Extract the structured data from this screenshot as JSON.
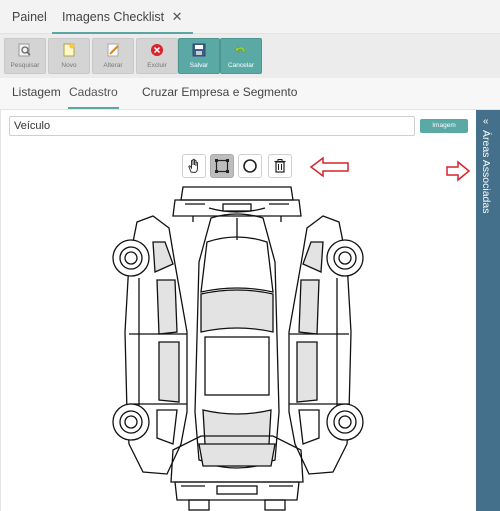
{
  "top_tabs": [
    {
      "label": "Painel"
    },
    {
      "label": "Imagens Checklist",
      "close": "✕"
    }
  ],
  "toolbar": {
    "buttons": [
      {
        "label": "Pesquisar",
        "icon": "search-icon"
      },
      {
        "label": "Novo",
        "icon": "new-doc-icon"
      },
      {
        "label": "Alterar",
        "icon": "edit-icon"
      },
      {
        "label": "Excluir",
        "icon": "delete-icon"
      },
      {
        "label": "Salvar",
        "icon": "save-icon"
      },
      {
        "label": "Cancelar",
        "icon": "cancel-icon"
      }
    ]
  },
  "sub_tabs": [
    {
      "label": "Listagem"
    },
    {
      "label": "Cadastro",
      "active": true
    },
    {
      "label": "Cruzar Empresa e Segmento"
    }
  ],
  "form": {
    "vehicle_value": "Veículo",
    "image_button": "Imagem"
  },
  "drawing_tools": [
    {
      "icon": "hand-icon"
    },
    {
      "icon": "rectangle-select-icon",
      "active": true
    },
    {
      "icon": "circle-icon"
    },
    {
      "icon": "trash-icon"
    }
  ],
  "side_panel": {
    "chevron": "«",
    "label": "Áreas Associadas"
  },
  "colors": {
    "accent": "#5ba9a5",
    "side_panel": "#44708b",
    "arrow": "#d9232d"
  }
}
